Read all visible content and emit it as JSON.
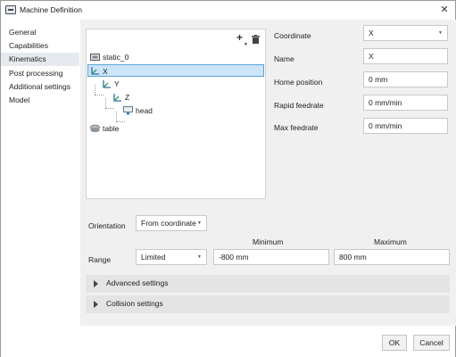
{
  "window": {
    "title": "Machine Definition"
  },
  "sidebar": {
    "items": [
      {
        "label": "General"
      },
      {
        "label": "Capabilities"
      },
      {
        "label": "Kinematics"
      },
      {
        "label": "Post processing"
      },
      {
        "label": "Additional settings"
      },
      {
        "label": "Model"
      }
    ],
    "active_index": 2
  },
  "tree": {
    "nodes": [
      {
        "label": "static_0",
        "icon": "machine-base-icon"
      },
      {
        "label": "X",
        "icon": "axis-icon",
        "selected": true
      },
      {
        "label": "Y",
        "icon": "axis-icon"
      },
      {
        "label": "Z",
        "icon": "axis-icon"
      },
      {
        "label": "head",
        "icon": "spindle-head-icon"
      },
      {
        "label": "table",
        "icon": "table-icon"
      }
    ]
  },
  "properties": {
    "coordinate_label": "Coordinate",
    "coordinate_value": "X",
    "name_label": "Name",
    "name_value": "X",
    "home_position_label": "Home position",
    "home_position_value": "0 mm",
    "rapid_feedrate_label": "Rapid feedrate",
    "rapid_feedrate_value": "0 mm/min",
    "max_feedrate_label": "Max feedrate",
    "max_feedrate_value": "0 mm/min"
  },
  "orientation": {
    "label": "Orientation",
    "value": "From coordinate"
  },
  "range": {
    "label": "Range",
    "mode": "Limited",
    "minimum_header": "Minimum",
    "maximum_header": "Maximum",
    "minimum_value": "-800 mm",
    "maximum_value": "800 mm"
  },
  "sections": {
    "advanced": "Advanced settings",
    "collision": "Collision settings"
  },
  "footer": {
    "ok_label": "OK",
    "cancel_label": "Cancel"
  },
  "colors": {
    "selection_background": "#cce4f7",
    "selection_border": "#5aa3df",
    "axis_icon_blue": "#2b6cb0",
    "panel_background": "#f0f0f0"
  }
}
